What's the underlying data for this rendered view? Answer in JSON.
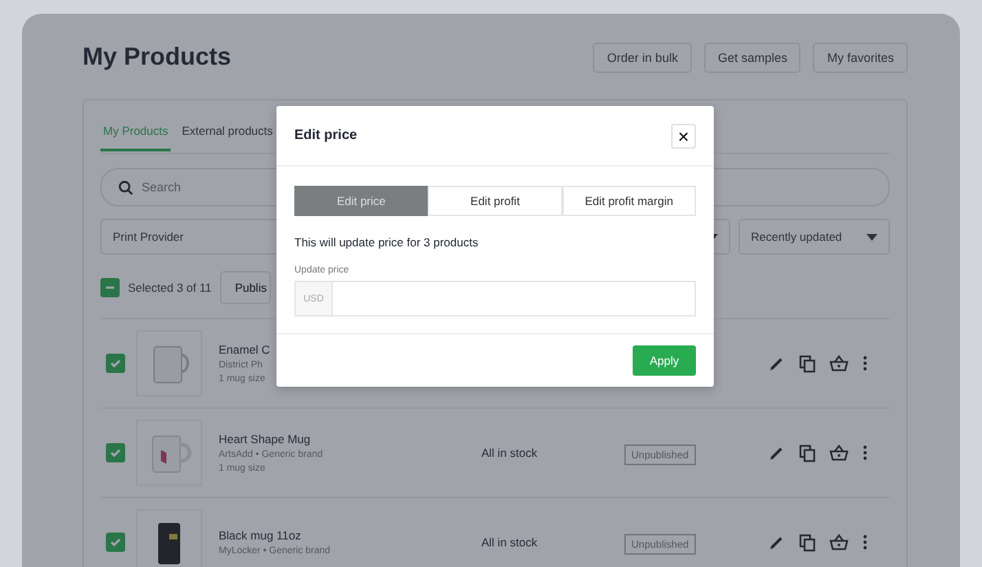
{
  "header": {
    "title": "My Products",
    "buttons": [
      "Order in bulk",
      "Get samples",
      "My favorites"
    ]
  },
  "tabs": [
    {
      "label": "My Products",
      "selected": true
    },
    {
      "label": "External products",
      "selected": false
    }
  ],
  "search": {
    "placeholder": "Search"
  },
  "filters": {
    "provider": "Print Provider",
    "sort": "Recently updated"
  },
  "selection": {
    "checked": true,
    "label": "Selected 3 of 11",
    "action": "Publis"
  },
  "products": [
    {
      "kind": "white-mug",
      "checked": true,
      "name": "Enamel C",
      "provider": "District Ph",
      "variants": "1 mug size"
    },
    {
      "kind": "heart-mug",
      "checked": true,
      "name": "Heart Shape Mug",
      "provider": "ArtsAdd • Generic brand",
      "variants": "1 mug size",
      "stock": "All in stock",
      "status": "Unpublished"
    },
    {
      "kind": "black-mug",
      "checked": true,
      "name": "Black mug 11oz",
      "provider": "MyLocker • Generic brand",
      "stock": "All in stock",
      "status": "Unpublished"
    }
  ],
  "modal": {
    "title": "Edit price",
    "close": "×",
    "tabs": [
      {
        "label": "Edit price",
        "selected": true
      },
      {
        "label": "Edit profit",
        "selected": false
      },
      {
        "label": "Edit profit margin",
        "selected": false
      }
    ],
    "note": "This will update price for 3 products",
    "field": {
      "label": "Update price",
      "prefix": "USD"
    },
    "button": "Apply"
  }
}
